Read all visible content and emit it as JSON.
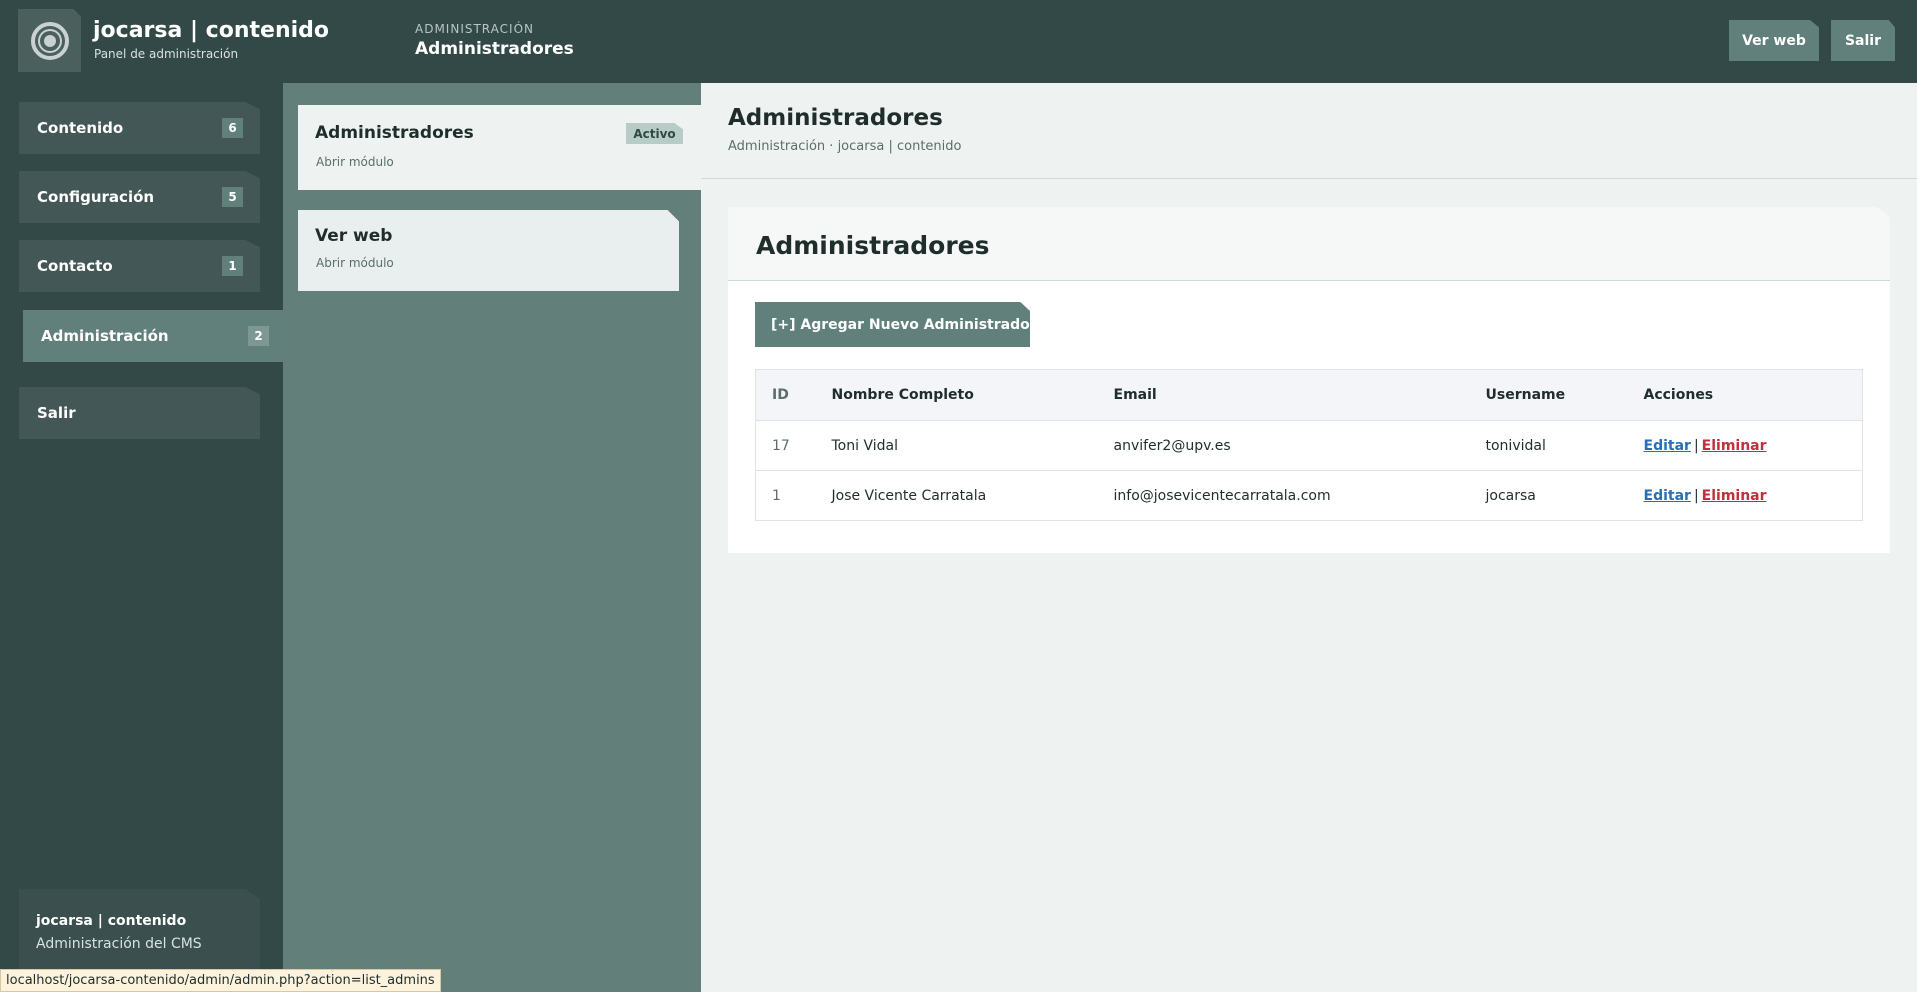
{
  "header": {
    "brand_title": "jocarsa | contenido",
    "brand_subtitle": "Panel de administración",
    "section_small": "ADMINISTRACIÓN",
    "section_title": "Administradores",
    "ver_web_label": "Ver web",
    "salir_label": "Salir"
  },
  "sidebar": {
    "items": [
      {
        "label": "Contenido",
        "count": "6"
      },
      {
        "label": "Configuración",
        "count": "5"
      },
      {
        "label": "Contacto",
        "count": "1"
      },
      {
        "label": "Administración",
        "count": "2"
      },
      {
        "label": "Salir"
      }
    ],
    "footer_title": "jocarsa | contenido",
    "footer_subtitle": "Administración del CMS"
  },
  "modules": {
    "items": [
      {
        "title": "Administradores",
        "subtitle": "Abrir módulo",
        "badge": "Activo"
      },
      {
        "title": "Ver web",
        "subtitle": "Abrir módulo"
      }
    ]
  },
  "main": {
    "title": "Administradores",
    "breadcrumb": "Administración · jocarsa | contenido",
    "panel_title": "Administradores",
    "add_button": "[+] Agregar Nuevo Administrador",
    "table": {
      "headers": [
        "ID",
        "Nombre Completo",
        "Email",
        "Username",
        "Acciones"
      ],
      "rows": [
        {
          "id": "17",
          "name": "Toni Vidal",
          "email": "anvifer2@upv.es",
          "username": "tonividal",
          "edit": "Editar",
          "sep": "|",
          "delete": "Eliminar"
        },
        {
          "id": "1",
          "name": "Jose Vicente Carratala",
          "email": "info@josevicentecarratala.com",
          "username": "jocarsa",
          "edit": "Editar",
          "sep": "|",
          "delete": "Eliminar"
        }
      ]
    }
  },
  "statusbar": {
    "url": "localhost/jocarsa-contenido/admin/admin.php?action=list_admins"
  },
  "colors": {
    "header_bg": "#334947",
    "accent": "#62807b",
    "module_bg": "#627f7a",
    "link_edit": "#2a6fb3",
    "link_delete": "#c0303a"
  }
}
